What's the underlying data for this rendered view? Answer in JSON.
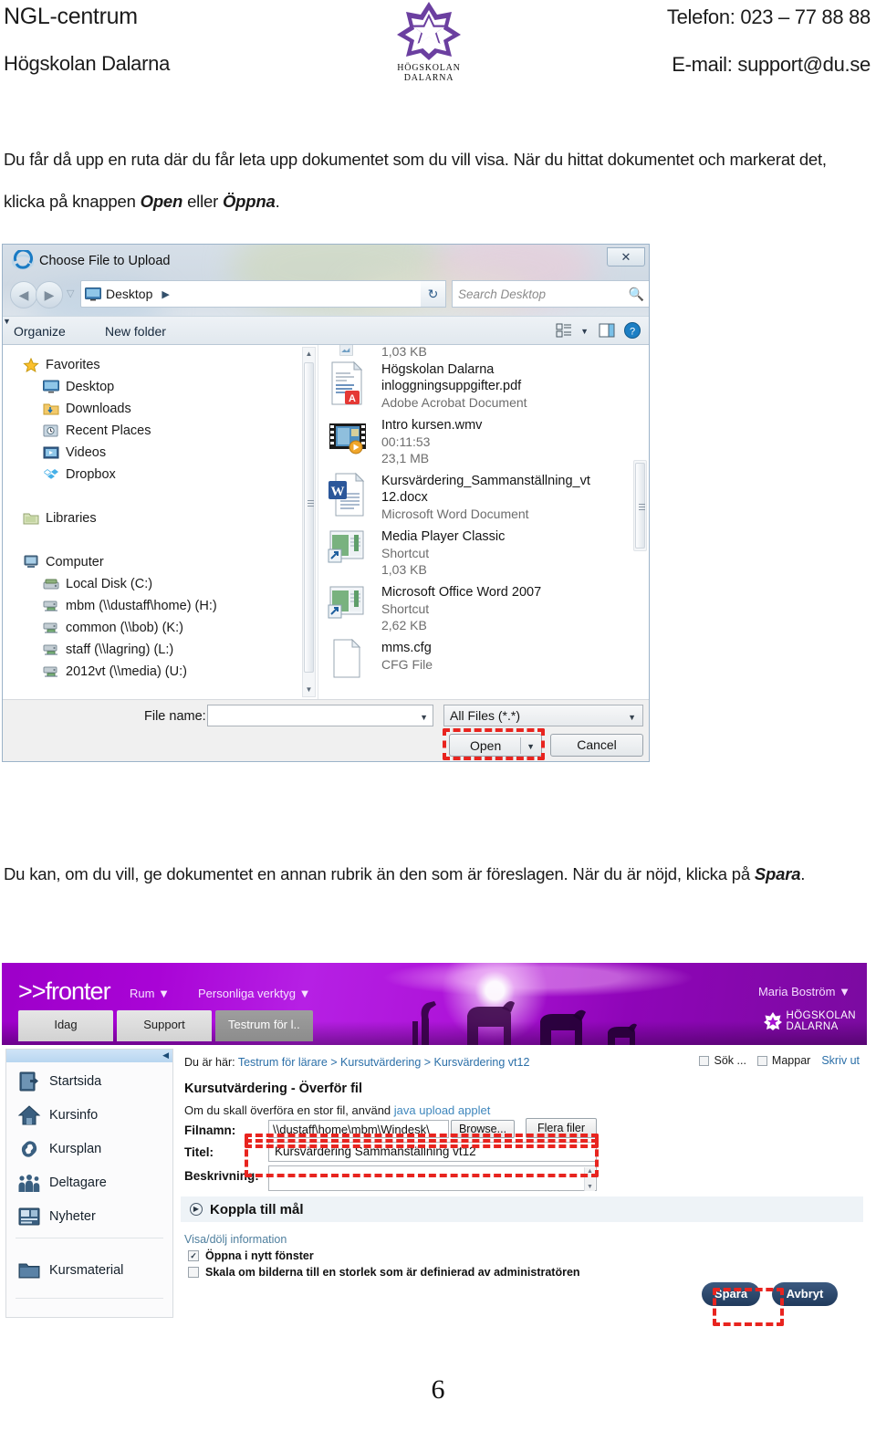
{
  "header": {
    "left_line1": "NGL-centrum",
    "left_line2": "Högskolan Dalarna",
    "right_line1": "Telefon: 023 – 77 88 88",
    "right_line2": "E-mail: support@du.se",
    "logo_line1": "HÖGSKOLAN",
    "logo_line2": "DALARNA",
    "logo_color": "#6b3fa0"
  },
  "paragraph1": {
    "part1": "Du får då upp en ruta där du får leta upp dokumentet som du vill visa. När du hittat dokumentet och markerat det, klicka på knappen ",
    "bold1": "Open",
    "mid": " eller ",
    "bold2": "Öppna",
    "end": "."
  },
  "paragraph2": {
    "part1": "Du kan, om du vill, ge dokumentet en annan rubrik än den som är föreslagen. När du är nöjd, klicka på ",
    "bold1": "Spara",
    "end": "."
  },
  "file_dialog": {
    "title": "Choose File to Upload",
    "close_label": "✕",
    "address": {
      "location": "Desktop",
      "separator": "▶",
      "caret": "▼"
    },
    "search": {
      "placeholder": "Search Desktop",
      "icon": "search-icon"
    },
    "refresh_icon": "refresh-icon",
    "toolbar": {
      "organize": "Organize",
      "organize_caret": "▼",
      "new_folder": "New folder",
      "view_caret": "▼",
      "view_icon": "view-list-icon",
      "preview_icon": "preview-pane-icon",
      "help_icon": "help-icon"
    },
    "nav_pane": [
      {
        "label": "Favorites",
        "icon": "star-icon",
        "level": "group"
      },
      {
        "label": "Desktop",
        "icon": "desktop-icon",
        "level": "child"
      },
      {
        "label": "Downloads",
        "icon": "downloads-icon",
        "level": "child"
      },
      {
        "label": "Recent Places",
        "icon": "recent-icon",
        "level": "child"
      },
      {
        "label": "Videos",
        "icon": "videos-icon",
        "level": "child"
      },
      {
        "label": "Dropbox",
        "icon": "dropbox-icon",
        "level": "child"
      },
      {
        "label": "Libraries",
        "icon": "library-icon",
        "level": "group"
      },
      {
        "label": "Computer",
        "icon": "computer-icon",
        "level": "group"
      },
      {
        "label": "Local Disk (C:)",
        "icon": "harddisk-icon",
        "level": "child"
      },
      {
        "label": "mbm (\\\\dustaff\\home) (H:)",
        "icon": "netdrive-icon",
        "level": "child"
      },
      {
        "label": "common (\\\\bob) (K:)",
        "icon": "netdrive-icon",
        "level": "child"
      },
      {
        "label": "staff (\\\\lagring) (L:)",
        "icon": "netdrive-icon",
        "level": "child"
      },
      {
        "label": "2012vt (\\\\media) (U:)",
        "icon": "netdrive-icon",
        "level": "child"
      }
    ],
    "files": [
      {
        "name": "",
        "line2": "1,03 KB",
        "line3": "",
        "icon": "shortcut-icon"
      },
      {
        "name": "Högskolan Dalarna inloggningsuppgifter.pdf",
        "line2": "Adobe Acrobat Document",
        "line3": "",
        "icon": "pdf-icon"
      },
      {
        "name": "Intro kursen.wmv",
        "line2": "00:11:53",
        "line3": "23,1 MB",
        "icon": "video-icon"
      },
      {
        "name": "Kursvärdering_Sammanställning_vt 12.docx",
        "line2": "Microsoft Word Document",
        "line3": "",
        "icon": "word-icon"
      },
      {
        "name": "Media Player Classic",
        "line2": "Shortcut",
        "line3": "1,03 KB",
        "icon": "shortcut-icon"
      },
      {
        "name": "Microsoft Office Word 2007",
        "line2": "Shortcut",
        "line3": "2,62 KB",
        "icon": "shortcut-icon"
      },
      {
        "name": "mms.cfg",
        "line2": "CFG File",
        "line3": "",
        "icon": "file-icon"
      }
    ],
    "footer": {
      "file_name_label": "File name:",
      "file_name_value": "",
      "file_name_caret": "▼",
      "filter_value": "All Files (*.*)",
      "filter_caret": "▼",
      "open_label": "Open",
      "open_caret": "▼",
      "cancel_label": "Cancel"
    },
    "highlight_color": "#e8241f"
  },
  "fronter": {
    "logo": ">>fronter",
    "nav": [
      {
        "label": "Rum",
        "caret": "▼"
      },
      {
        "label": "Personliga verktyg",
        "caret": "▼"
      }
    ],
    "user": "Maria Boström",
    "user_caret": "▼",
    "brand_line1": "HÖGSKOLAN",
    "brand_line2": "DALARNA",
    "tabs": [
      {
        "label": "Idag",
        "active": false
      },
      {
        "label": "Support",
        "active": false
      },
      {
        "label": "Testrum för l..",
        "active": true
      }
    ],
    "sidebar": [
      {
        "label": "Startsida",
        "icon": "startpage-icon"
      },
      {
        "label": "Kursinfo",
        "icon": "home-icon"
      },
      {
        "label": "Kursplan",
        "icon": "link-icon"
      },
      {
        "label": "Deltagare",
        "icon": "people-icon"
      },
      {
        "label": "Nyheter",
        "icon": "news-icon"
      },
      {
        "label": "Kursmaterial",
        "icon": "folder-icon"
      }
    ],
    "breadcrumb_lead": "Du är här:",
    "breadcrumb": "Testrum för lärare > Kursutvärdering > Kursvärdering vt12",
    "tools": [
      {
        "label": "Sök ...",
        "checkbox": true
      },
      {
        "label": "Mappar",
        "checkbox": true
      }
    ],
    "print_link": "Skriv ut",
    "page_title": "Kursutvärdering - Överför fil",
    "hint_prefix": "Om du skall överföra en stor fil, använd ",
    "hint_link": "java upload applet",
    "form": {
      "filnamn_label": "Filnamn:",
      "filnamn_value": "\\\\dustaff\\home\\mbm\\Windesk\\",
      "browse_label": "Browse...",
      "flera_filer_label": "Flera filer",
      "titel_label": "Titel:",
      "titel_value": "Kursvärdering Sammanställning vt12",
      "beskrivning_label": "Beskrivning:",
      "beskrivning_value": ""
    },
    "koppla_label": "Koppla till mål",
    "koppla_arrow": "▶",
    "visa_label": "Visa/dölj information",
    "checkboxes": [
      {
        "label": "Öppna i nytt fönster",
        "checked": true,
        "mark": "✓"
      },
      {
        "label": "Skala om bilderna till en storlek som är definierad av administratören",
        "checked": false,
        "mark": ""
      }
    ],
    "save_label": "Spara",
    "cancel_label": "Avbryt",
    "accent_purple": "#a50fd2",
    "button_blue": "#2b4a70"
  },
  "page_number": "6"
}
